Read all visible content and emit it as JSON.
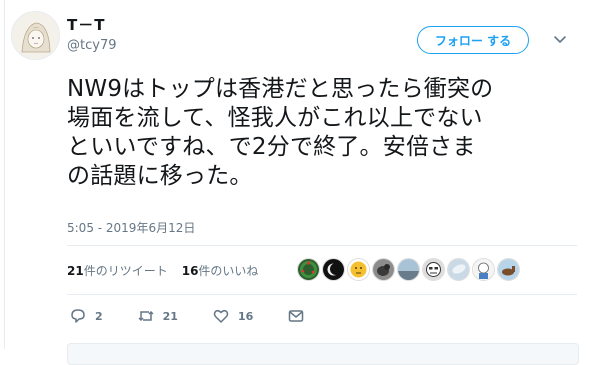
{
  "user": {
    "display_name": "T－T",
    "handle": "@tcy79"
  },
  "follow_button_label": "フォロー する",
  "tweet": {
    "text": "NW9はトップは香港だと思ったら衝突の\n場面を流して、怪我人がこれ以上でない\nといいですね、で2分で終了。安倍さま\nの話題に移った。",
    "timestamp": "5:05 - 2019年6月12日"
  },
  "stats": {
    "retweets_count": "21",
    "retweets_label": "件のリツイート",
    "likes_count": "16",
    "likes_label": "件のいいね"
  },
  "liker_avatars": [
    "christmas-wreath-avatar",
    "moon-eclipse-avatar",
    "thinking-emoji-avatar",
    "dog-photo-avatar",
    "landscape-avatar",
    "cartoon-face-avatar",
    "sky-avatar",
    "character-avatar",
    "horse-avatar"
  ],
  "actions": {
    "reply_count": "2",
    "retweet_count": "21",
    "like_count": "16"
  },
  "colors": {
    "accent": "#1da1f2",
    "muted": "#657786",
    "text": "#14171a"
  }
}
